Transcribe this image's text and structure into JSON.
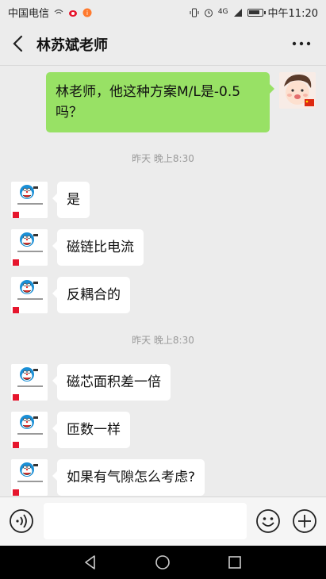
{
  "status_bar": {
    "carrier": "中国电信",
    "network": "4G",
    "time": "中午11:20",
    "icons": [
      "wifi-icon",
      "weibo-icon",
      "app-icon",
      "vibrate-icon",
      "alarm-icon",
      "signal-icon",
      "battery-icon"
    ],
    "battery_level": 0.85
  },
  "header": {
    "title": "林苏斌老师",
    "back_icon": "chevron-left-icon",
    "more_icon": "more-dots-icon"
  },
  "messages": [
    {
      "type": "outgoing",
      "text_line1": "林老师，他这种方案M/L是-0.5",
      "text_line2": "吗？"
    },
    {
      "type": "time",
      "text": "昨天 晚上8:30"
    },
    {
      "type": "incoming",
      "text": "是"
    },
    {
      "type": "incoming",
      "text": "磁链比电流"
    },
    {
      "type": "incoming",
      "text": "反耦合的"
    },
    {
      "type": "time",
      "text": "昨天 晚上8:30"
    },
    {
      "type": "incoming",
      "text": "磁芯面积差一倍"
    },
    {
      "type": "incoming",
      "text": "匝数一样"
    },
    {
      "type": "incoming",
      "text": "如果有气隙怎么考虑?"
    }
  ],
  "input_bar": {
    "placeholder": "",
    "voice_icon": "voice-icon",
    "emoji_icon": "emoji-icon",
    "plus_icon": "plus-icon"
  },
  "nav_bar": {
    "icons": [
      "nav-back-icon",
      "nav-home-icon",
      "nav-recents-icon"
    ]
  },
  "colors": {
    "background": "#ececec",
    "outgoing_bubble": "#98e165",
    "incoming_bubble": "#ffffff",
    "timestamp": "#9a9a9a"
  }
}
